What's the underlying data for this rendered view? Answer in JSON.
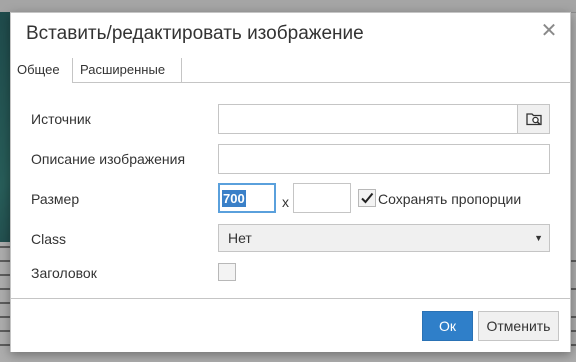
{
  "dialog": {
    "title": "Вставить/редактировать изображение",
    "close_glyph": "✕"
  },
  "tabs": [
    {
      "label": "Общее",
      "active": true
    },
    {
      "label": "Расширенные",
      "active": false
    }
  ],
  "form": {
    "source_label": "Источник",
    "source_value": "",
    "description_label": "Описание изображения",
    "description_value": "",
    "size_label": "Размер",
    "width_value": "700",
    "times_sign": "x",
    "height_value": "",
    "keep_proportions_label": "Сохранять пропорции",
    "keep_proportions_checked": true,
    "class_label": "Class",
    "class_value": "Нет",
    "caption_label": "Заголовок",
    "caption_checked": false
  },
  "buttons": {
    "ok_label": "Ок",
    "cancel_label": "Отменить"
  },
  "colors": {
    "primary": "#2f7fc9",
    "focus_border": "#5aa0dc",
    "selection": "#3a80c8"
  },
  "icons": {
    "browse": "folder-search-icon",
    "close": "close-icon",
    "dropdown": "caret-down-icon",
    "check": "checkmark-icon"
  }
}
